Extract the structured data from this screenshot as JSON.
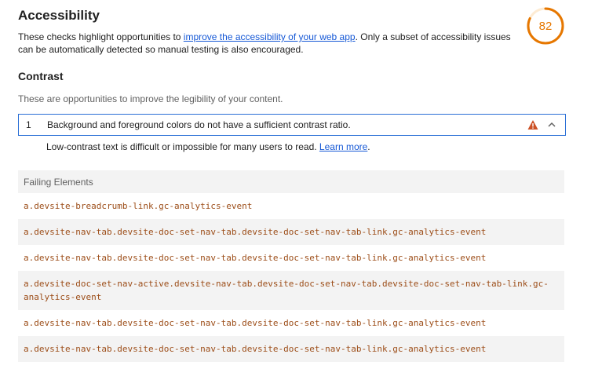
{
  "header": {
    "title": "Accessibility",
    "desc_pre": "These checks highlight opportunities to ",
    "desc_link": "improve the accessibility of your web app",
    "desc_post": ". Only a subset of accessibility issues can be automatically detected so manual testing is also encouraged."
  },
  "score": {
    "value": "82",
    "fraction": 0.82,
    "color": "#e67700",
    "track": "#fdebd3"
  },
  "section": {
    "title": "Contrast",
    "description": "These are opportunities to improve the legibility of your content."
  },
  "audit": {
    "index": "1",
    "title": "Background and foreground colors do not have a sufficient contrast ratio.",
    "status_icon": "warning-triangle-icon",
    "toggle_icon": "chevron-up-icon",
    "detail_text": "Low-contrast text is difficult or impossible for many users to read. ",
    "detail_link": "Learn more",
    "detail_end": "."
  },
  "table": {
    "header": "Failing Elements",
    "rows": [
      "a.devsite-breadcrumb-link.gc-analytics-event",
      "a.devsite-nav-tab.devsite-doc-set-nav-tab.devsite-doc-set-nav-tab-link.gc-analytics-event",
      "a.devsite-nav-tab.devsite-doc-set-nav-tab.devsite-doc-set-nav-tab-link.gc-analytics-event",
      "a.devsite-doc-set-nav-active.devsite-nav-tab.devsite-doc-set-nav-tab.devsite-doc-set-nav-tab-link.gc-analytics-event",
      "a.devsite-nav-tab.devsite-doc-set-nav-tab.devsite-doc-set-nav-tab-link.gc-analytics-event",
      "a.devsite-nav-tab.devsite-doc-set-nav-tab.devsite-doc-set-nav-tab-link.gc-analytics-event"
    ]
  }
}
